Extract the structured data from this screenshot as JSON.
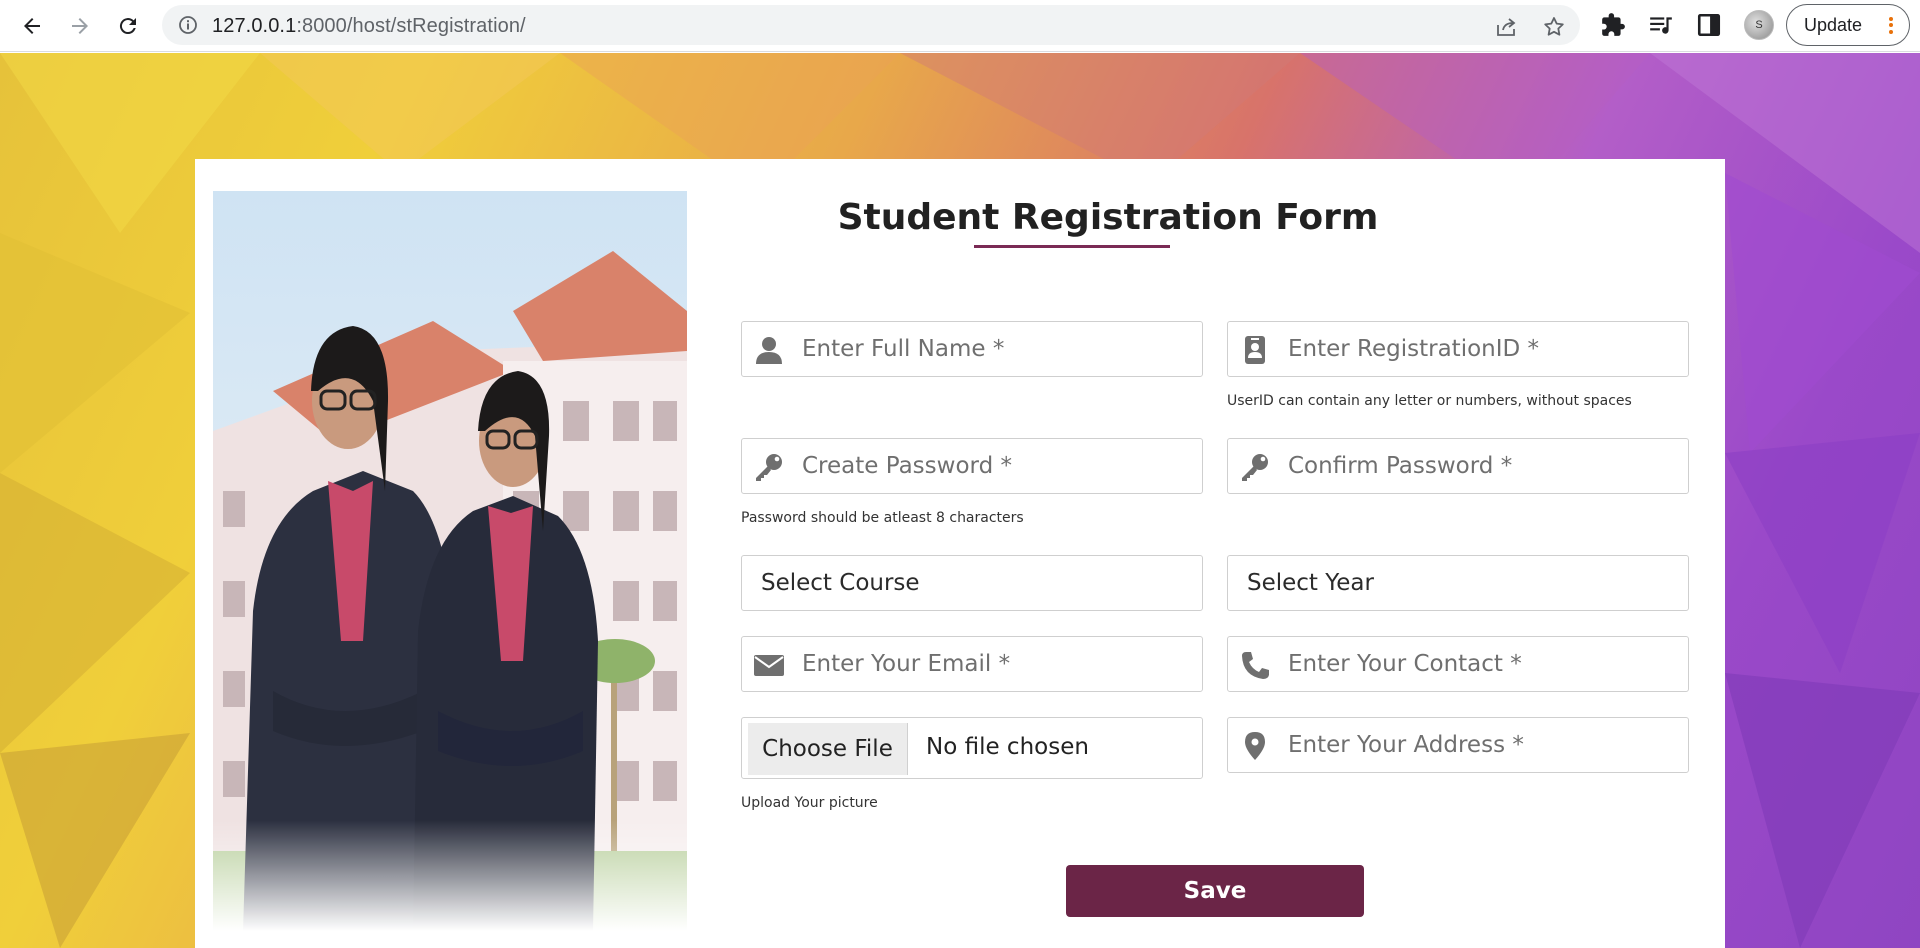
{
  "browser": {
    "url_host": "127.0.0.1",
    "url_path": ":8000/host/stRegistration/",
    "update_label": "Update",
    "profile_initial": "S"
  },
  "form": {
    "title_part1": "Student ",
    "title_part2": "Registration",
    "title_part3": " Form",
    "full_name_placeholder": "Enter Full Name *",
    "registration_id_placeholder": "Enter RegistrationID *",
    "registration_id_hint": "UserID can contain any letter or numbers, without spaces",
    "create_password_placeholder": "Create Password *",
    "confirm_password_placeholder": "Confirm Password *",
    "password_hint": "Password should be atleast 8 characters",
    "course_select": "Select Course",
    "year_select": "Select Year",
    "email_placeholder": "Enter Your Email *",
    "contact_placeholder": "Enter Your Contact *",
    "choose_file_label": "Choose File",
    "no_file_label": "No file chosen",
    "upload_hint": "Upload Your picture",
    "address_placeholder": "Enter Your Address *",
    "save_label": "Save"
  },
  "colors": {
    "accent": "#6b2547",
    "icon": "#6f6f6f"
  }
}
